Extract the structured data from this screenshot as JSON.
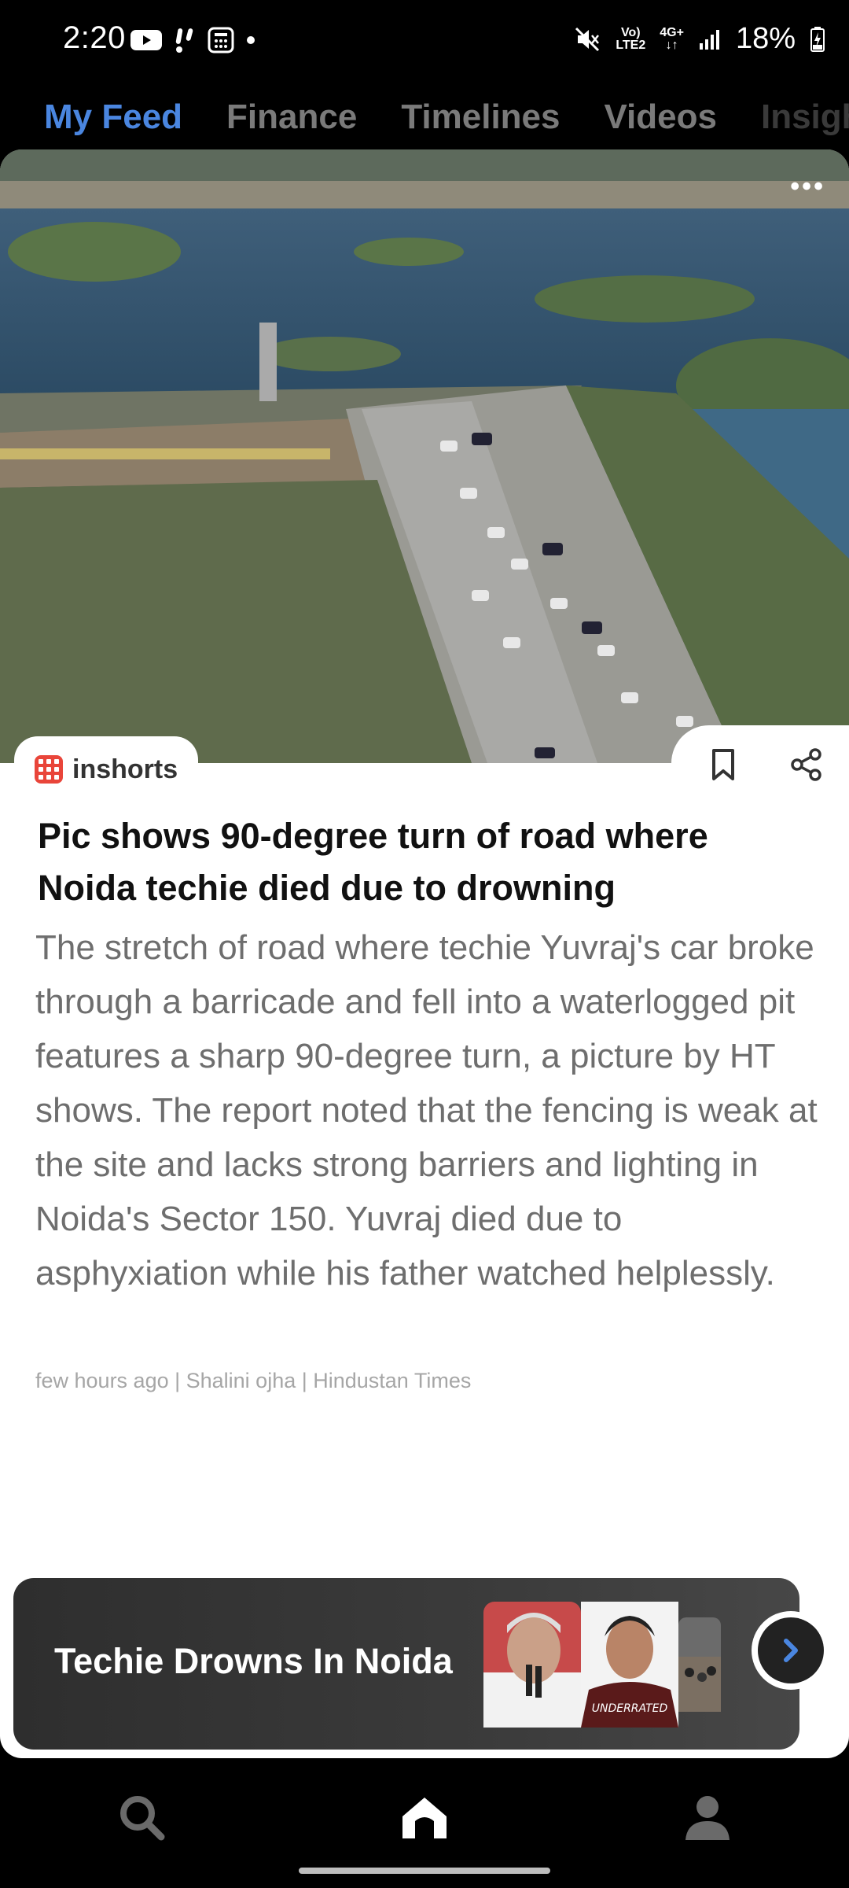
{
  "status_bar": {
    "time": "2:20",
    "network_top": "Vo)",
    "network_bottom": "LTE2",
    "signal_label": "4G+",
    "battery": "18%"
  },
  "tabs": [
    {
      "label": "My Feed",
      "active": true
    },
    {
      "label": "Finance",
      "active": false
    },
    {
      "label": "Timelines",
      "active": false
    },
    {
      "label": "Videos",
      "active": false
    },
    {
      "label": "Insigh",
      "active": false
    }
  ],
  "article": {
    "brand": "inshorts",
    "headline": "Pic shows 90-degree turn of road where Noida techie died due to drowning",
    "body": "The stretch of road where techie Yuvraj's car broke through a barricade and fell into a waterlogged pit features a sharp 90-degree turn, a picture by HT shows. The report noted that the fencing is weak at the site and lacks strong barriers and lighting in Noida's Sector 150. Yuvraj died due to asphyxiation while his father watched helplessly.",
    "meta": "few hours ago | Shalini ojha | Hindustan Times"
  },
  "banner": {
    "title": "Techie Drowns In Noida",
    "thumb_text": "UNDERRATED"
  },
  "icons": {
    "more": "more-dots-icon",
    "bookmark": "bookmark-icon",
    "share": "share-icon",
    "next": "chevron-right-icon",
    "search": "search-icon",
    "home": "home-icon",
    "profile": "profile-icon"
  },
  "colors": {
    "active_tab": "#4a86e0",
    "brand_red": "#e9453a",
    "background": "#000000"
  }
}
